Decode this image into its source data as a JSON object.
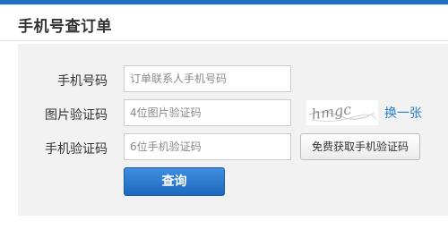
{
  "page": {
    "title": "手机号查订单"
  },
  "form": {
    "phone": {
      "label": "手机号码",
      "placeholder": "订单联系人手机号码"
    },
    "image_captcha": {
      "label": "图片验证码",
      "placeholder": "4位图片验证码",
      "captcha_text": "hmgc",
      "refresh_label": "换一张"
    },
    "sms_code": {
      "label": "手机验证码",
      "placeholder": "6位手机验证码",
      "send_button": "免费获取手机验证码"
    },
    "submit_label": "查询"
  },
  "colors": {
    "accent": "#1e6fc6",
    "link": "#2a80c8",
    "panel_bg": "#f2f2f2"
  },
  "icons": []
}
